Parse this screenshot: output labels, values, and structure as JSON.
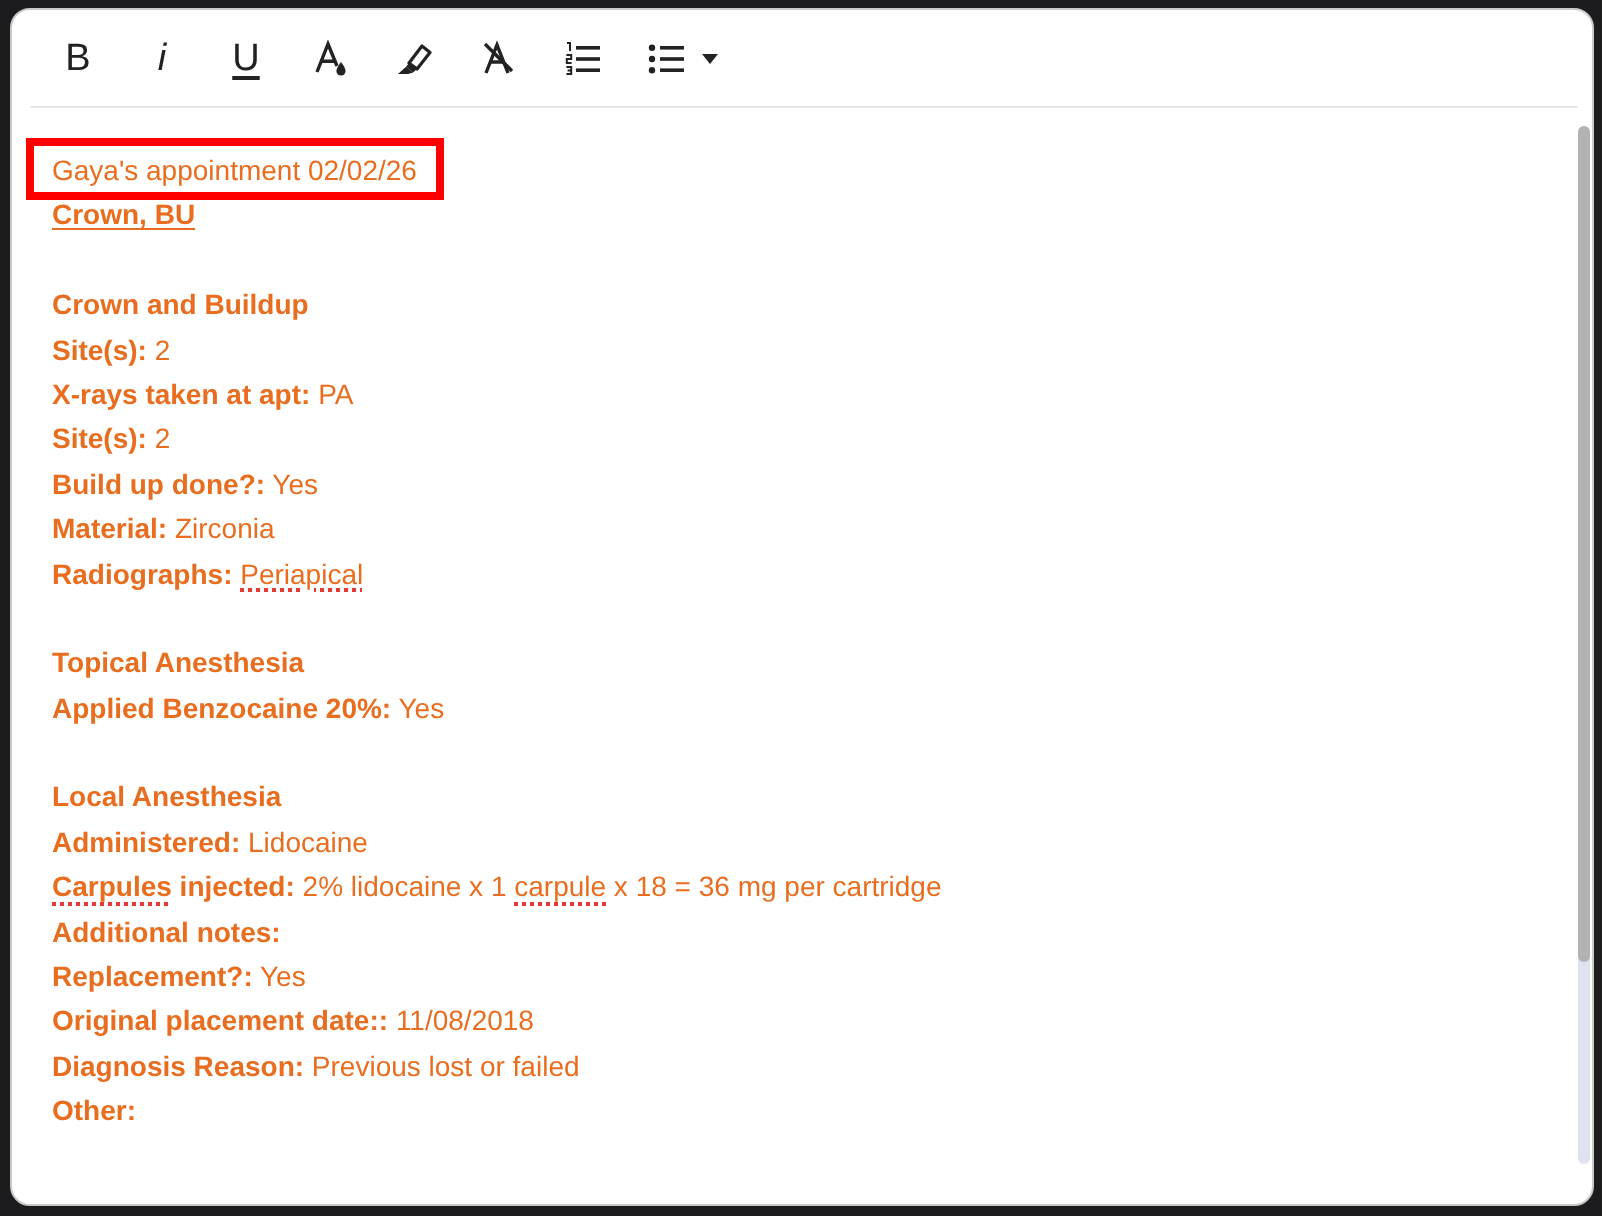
{
  "toolbar": {
    "tools": [
      {
        "kind": "bold",
        "label": "B",
        "dropdown": false
      },
      {
        "kind": "italic",
        "label": "i",
        "dropdown": false
      },
      {
        "kind": "underline",
        "label": "U",
        "dropdown": false
      },
      {
        "kind": "font-color",
        "dropdown": false
      },
      {
        "kind": "highlight",
        "dropdown": false
      },
      {
        "kind": "clear-format",
        "dropdown": false
      },
      {
        "kind": "ordered-list",
        "dropdown": false
      },
      {
        "kind": "bullet-list",
        "dropdown": true
      }
    ]
  },
  "note": {
    "sections": [
      {
        "lines": [
          {
            "kind": "plain",
            "text": "Gaya's appointment 02/02/26",
            "highlighted": true
          },
          {
            "kind": "heading",
            "text": "Crown, BU",
            "underlined": true
          }
        ]
      },
      {
        "lines": [
          {
            "kind": "heading",
            "text": "Crown and Buildup",
            "underlined": false
          },
          {
            "kind": "field",
            "label": [
              {
                "text": "Site(s):",
                "misspelled": false
              }
            ],
            "value": [
              {
                "text": "2",
                "misspelled": false
              }
            ]
          },
          {
            "kind": "field",
            "label": [
              {
                "text": "X-rays taken at apt:",
                "misspelled": false
              }
            ],
            "value": [
              {
                "text": "PA",
                "misspelled": false
              }
            ]
          },
          {
            "kind": "field",
            "label": [
              {
                "text": "Site(s):",
                "misspelled": false
              }
            ],
            "value": [
              {
                "text": "2",
                "misspelled": false
              }
            ]
          },
          {
            "kind": "field",
            "label": [
              {
                "text": "Build up done?:",
                "misspelled": false
              }
            ],
            "value": [
              {
                "text": "Yes",
                "misspelled": false
              }
            ]
          },
          {
            "kind": "field",
            "label": [
              {
                "text": "Material:",
                "misspelled": false
              }
            ],
            "value": [
              {
                "text": "Zirconia",
                "misspelled": false
              }
            ]
          },
          {
            "kind": "field",
            "label": [
              {
                "text": "Radiographs:",
                "misspelled": false
              }
            ],
            "value": [
              {
                "text": "Periapical",
                "misspelled": true
              }
            ]
          }
        ]
      },
      {
        "lines": [
          {
            "kind": "heading",
            "text": "Topical Anesthesia",
            "underlined": false
          },
          {
            "kind": "field",
            "label": [
              {
                "text": "Applied Benzocaine 20%:",
                "misspelled": false
              }
            ],
            "value": [
              {
                "text": "Yes",
                "misspelled": false
              }
            ]
          }
        ]
      },
      {
        "lines": [
          {
            "kind": "heading",
            "text": "Local Anesthesia",
            "underlined": false
          },
          {
            "kind": "field",
            "label": [
              {
                "text": "Administered:",
                "misspelled": false
              }
            ],
            "value": [
              {
                "text": "Lidocaine",
                "misspelled": false
              }
            ]
          },
          {
            "kind": "field",
            "label": [
              {
                "text": "Carpules",
                "misspelled": true
              },
              {
                "text": " injected:",
                "misspelled": false
              }
            ],
            "value": [
              {
                "text": "2% lidocaine x 1 ",
                "misspelled": false
              },
              {
                "text": "carpule",
                "misspelled": true
              },
              {
                "text": " x 18 = 36 mg per cartridge",
                "misspelled": false
              }
            ]
          },
          {
            "kind": "field",
            "label": [
              {
                "text": "Additional notes:",
                "misspelled": false
              }
            ]
          },
          {
            "kind": "field",
            "label": [
              {
                "text": "Replacement?:",
                "misspelled": false
              }
            ],
            "value": [
              {
                "text": "Yes",
                "misspelled": false
              }
            ]
          },
          {
            "kind": "field",
            "label": [
              {
                "text": "Original placement date::",
                "misspelled": false
              }
            ],
            "value": [
              {
                "text": "11/08/2018",
                "misspelled": false
              }
            ]
          },
          {
            "kind": "field",
            "label": [
              {
                "text": "Diagnosis Reason:",
                "misspelled": false
              }
            ],
            "value": [
              {
                "text": "Previous lost or failed",
                "misspelled": false
              }
            ]
          },
          {
            "kind": "field",
            "label": [
              {
                "text": "Other:",
                "misspelled": false
              }
            ]
          }
        ]
      }
    ]
  }
}
